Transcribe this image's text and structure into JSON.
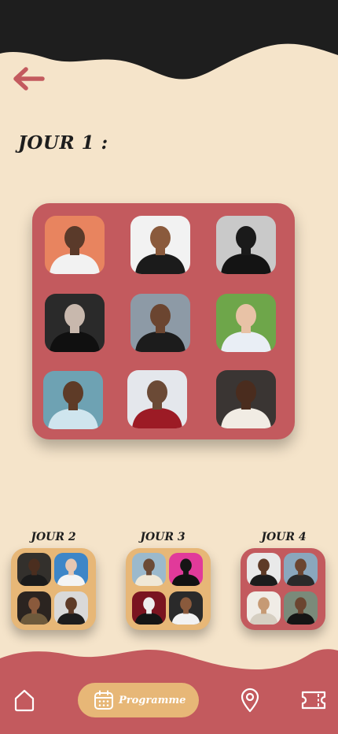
{
  "header": {
    "back_icon": "arrow-left-icon"
  },
  "day_main": {
    "title": "JOUR 1 :",
    "artists": [
      {
        "name": "artist-1",
        "bg": "#e8845f",
        "skin": "#5a3a2a",
        "shirt": "#f2f2f2"
      },
      {
        "name": "artist-2",
        "bg": "#f2f2f2",
        "skin": "#8a5a3c",
        "shirt": "#1b1b1b"
      },
      {
        "name": "artist-3",
        "bg": "#c9c9c9",
        "skin": "#1a1a1a",
        "shirt": "#141414"
      },
      {
        "name": "artist-4",
        "bg": "#2a2a2a",
        "skin": "#c8b8ad",
        "shirt": "#101010"
      },
      {
        "name": "artist-5",
        "bg": "#8d9aa6",
        "skin": "#6b4530",
        "shirt": "#1c1c1c"
      },
      {
        "name": "artist-6",
        "bg": "#6ea64a",
        "skin": "#e8c2a6",
        "shirt": "#e9eef5"
      },
      {
        "name": "artist-7",
        "bg": "#6ea2b3",
        "skin": "#5e3b27",
        "shirt": "#cfe5ee"
      },
      {
        "name": "artist-8",
        "bg": "#e4e7ec",
        "skin": "#6b4a36",
        "shirt": "#9c1b25"
      },
      {
        "name": "artist-9",
        "bg": "#3a3533",
        "skin": "#4a2c1e",
        "shirt": "#f1ece4"
      }
    ]
  },
  "other_days": [
    {
      "label": "JOUR 2",
      "color": "#e7b777",
      "artists": [
        {
          "bg": "#33302c",
          "skin": "#4b2e1f",
          "shirt": "#1b1b1b"
        },
        {
          "bg": "#3d86c8",
          "skin": "#e6c7b2",
          "shirt": "#f4f4f4"
        },
        {
          "bg": "#2b2420",
          "skin": "#8a5a3c",
          "shirt": "#6e5a3c"
        },
        {
          "bg": "#d9d9d9",
          "skin": "#5e3b27",
          "shirt": "#1d1d1d"
        }
      ]
    },
    {
      "label": "JOUR 3",
      "color": "#e7b777",
      "artists": [
        {
          "bg": "#9bb9cc",
          "skin": "#6b4a36",
          "shirt": "#f0e8d6"
        },
        {
          "bg": "#e13a9a",
          "skin": "#151515",
          "shirt": "#121212"
        },
        {
          "bg": "#7a1420",
          "skin": "#eeeeee",
          "shirt": "#151515"
        },
        {
          "bg": "#2a2a2a",
          "skin": "#8a5a3c",
          "shirt": "#f2f2f2"
        }
      ]
    },
    {
      "label": "JOUR 4",
      "color": "#c35a5e",
      "artists": [
        {
          "bg": "#e9e9e9",
          "skin": "#5e3b27",
          "shirt": "#1c1c1c"
        },
        {
          "bg": "#8aa7bd",
          "skin": "#6b4530",
          "shirt": "#2a2a2a"
        },
        {
          "bg": "#f0ece6",
          "skin": "#c69a74",
          "shirt": "#d6cfc2"
        },
        {
          "bg": "#7a8a7a",
          "skin": "#6b4530",
          "shirt": "#151515"
        }
      ]
    }
  ],
  "nav": {
    "home_icon": "home-icon",
    "program_label": "Programme",
    "calendar_icon": "calendar-icon",
    "map_icon": "map-pin-icon",
    "ticket_icon": "ticket-icon",
    "active": "program"
  },
  "colors": {
    "background": "#f5e4ca",
    "dark": "#1e1e1e",
    "accent_red": "#c35a5e",
    "accent_gold": "#e7b777"
  }
}
